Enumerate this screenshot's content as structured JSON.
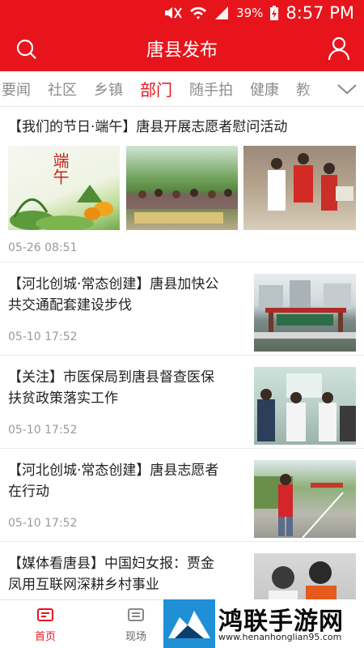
{
  "status": {
    "battery": "39%",
    "time": "8:57 PM"
  },
  "header": {
    "title": "唐县发布"
  },
  "tabs": [
    {
      "label": "要闻",
      "active": false
    },
    {
      "label": "社区",
      "active": false
    },
    {
      "label": "乡镇",
      "active": false
    },
    {
      "label": "部门",
      "active": true
    },
    {
      "label": "随手拍",
      "active": false
    },
    {
      "label": "健康",
      "active": false
    },
    {
      "label": "教",
      "active": false
    }
  ],
  "articles": [
    {
      "headline": "【我们的节日·端午】唐县开展志愿者慰问活动",
      "date": "05-26 08:51",
      "thumb_text": "端午"
    },
    {
      "headline_line1": "【河北创城·常态创建】唐县加快公",
      "headline_line2": "共交通配套建设步伐",
      "date": "05-10 17:52"
    },
    {
      "headline_line1": "【关注】市医保局到唐县督查医保",
      "headline_line2": "扶贫政策落实工作",
      "date": "05-10 17:52"
    },
    {
      "headline_line1": "【河北创城·常态创建】唐县志愿者",
      "headline_line2": "在行动",
      "date": "05-10 17:52"
    },
    {
      "headline_line1": "【媒体看唐县】中国妇女报：贾金",
      "headline_line2": "凤用互联网深耕乡村事业"
    }
  ],
  "bottom_nav": [
    {
      "label": "首页",
      "active": true
    },
    {
      "label": "现场",
      "active": false
    }
  ],
  "watermark": {
    "text": "鸿联手游网",
    "url": "www.henanhonglian95.com"
  },
  "colors": {
    "brand": "#e8141c",
    "muted": "#8c8c8c"
  }
}
